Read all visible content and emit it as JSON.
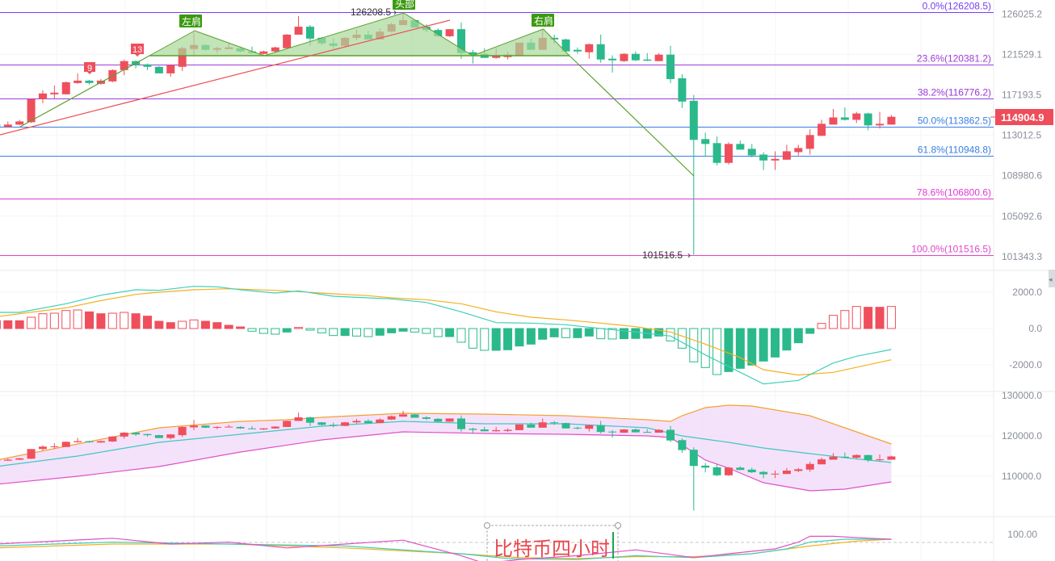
{
  "chart_data": {
    "type": "candlestick",
    "title": "比特币四小时",
    "colors": {
      "up": "#ef4f5c",
      "down": "#2bb98b",
      "fib0": "#7a3df0",
      "fib236": "#a23ad8",
      "fib382": "#9a3ad8",
      "fib50": "#3a7ee0",
      "fib618": "#3a7ee0",
      "fib786": "#e03ad0",
      "fib100": "#e048c8",
      "trend_red": "#ef4f5c",
      "pattern_green": "#5aa02c",
      "pattern_fill": "#a8d89a",
      "dif": "#3fd0b8",
      "dea": "#f5b020",
      "k": "#3fd0b8",
      "d": "#f5b020",
      "j": "#e050c8",
      "boll_up": "#f5a030",
      "boll_mid": "#3fc8c0",
      "boll_low": "#e050c8",
      "boll_fill": "#f0d8f8",
      "price_tag": "#ee4d5a"
    },
    "price_axis": {
      "scale": "log",
      "ticks": [
        "126025.2",
        "121529.1",
        "117193.5",
        "113012.5",
        "108980.6",
        "105092.6",
        "101343.3"
      ]
    },
    "current_price": "114904.9",
    "candles_ohlc": [
      [
        114102,
        114265,
        113938,
        113856
      ],
      [
        113856,
        114429,
        113856,
        114102
      ],
      [
        114102,
        114593,
        114020,
        114429
      ],
      [
        114347,
        116743,
        114265,
        116743
      ],
      [
        116743,
        117678,
        116318,
        117338
      ],
      [
        117253,
        118188,
        116743,
        117423
      ],
      [
        117253,
        118613,
        117253,
        118528
      ],
      [
        118443,
        119476,
        118358,
        118698
      ],
      [
        118698,
        118783,
        118273,
        118443
      ],
      [
        118358,
        118868,
        118273,
        118698
      ],
      [
        118613,
        119917,
        118528,
        119829
      ],
      [
        119829,
        120974,
        119293,
        120798
      ],
      [
        120798,
        120886,
        120005,
        120357
      ],
      [
        120445,
        120533,
        119829,
        120181
      ],
      [
        120181,
        120269,
        119476,
        119476
      ],
      [
        119476,
        120445,
        119123,
        120357
      ],
      [
        120181,
        122383,
        119741,
        122207
      ],
      [
        122119,
        123950,
        121415,
        122559
      ],
      [
        122559,
        122648,
        121942,
        122031
      ],
      [
        122031,
        122383,
        121678,
        122207
      ],
      [
        122119,
        122736,
        122119,
        122295
      ],
      [
        122207,
        122383,
        121766,
        121854
      ],
      [
        121854,
        122383,
        121591,
        121678
      ],
      [
        121591,
        121942,
        121503,
        121854
      ],
      [
        121854,
        122383,
        121766,
        122295
      ],
      [
        122207,
        123767,
        122207,
        123705
      ],
      [
        123705,
        125778,
        123705,
        124590
      ],
      [
        124590,
        124773,
        122471,
        123264
      ],
      [
        123352,
        123441,
        122559,
        122736
      ],
      [
        122736,
        123264,
        122119,
        122471
      ],
      [
        122471,
        123441,
        122383,
        123352
      ],
      [
        123352,
        124224,
        123088,
        123705
      ],
      [
        123705,
        124133,
        123176,
        123176
      ],
      [
        123176,
        124407,
        123176,
        124042
      ],
      [
        124042,
        125047,
        123950,
        124864
      ],
      [
        124773,
        126208.5,
        124773,
        125321
      ],
      [
        125321,
        125400,
        124499,
        124499
      ],
      [
        124590,
        124864,
        123950,
        124224
      ],
      [
        124224,
        124407,
        123441,
        123529
      ],
      [
        123529,
        124316,
        123441,
        124316
      ],
      [
        124316,
        125047,
        121062,
        121678
      ],
      [
        121766,
        122031,
        120533,
        121503
      ],
      [
        121591,
        122207,
        121150,
        121150
      ],
      [
        121150,
        122207,
        121062,
        121415
      ],
      [
        121238,
        121854,
        120974,
        121503
      ],
      [
        121415,
        122824,
        121415,
        122824
      ],
      [
        122824,
        123264,
        122031,
        122031
      ],
      [
        122031,
        124316,
        122031,
        123352
      ],
      [
        123352,
        123705,
        122736,
        123176
      ],
      [
        123176,
        123264,
        121854,
        121854
      ],
      [
        122031,
        122295,
        121591,
        121854
      ],
      [
        121766,
        122736,
        121062,
        122648
      ],
      [
        122648,
        123705,
        120622,
        120974
      ],
      [
        121062,
        121415,
        119564,
        120886
      ],
      [
        120798,
        121678,
        120710,
        121591
      ],
      [
        121591,
        121854,
        120798,
        120886
      ],
      [
        120974,
        121678,
        120798,
        120886
      ],
      [
        120798,
        121678,
        120798,
        121503
      ],
      [
        121503,
        122471,
        118443,
        118868
      ],
      [
        118953,
        119388,
        115808,
        116488
      ],
      [
        116573,
        117168,
        101516.5,
        112546
      ],
      [
        112628,
        113283,
        110956,
        112136
      ],
      [
        112218,
        112873,
        110008,
        110245
      ],
      [
        110245,
        112300,
        110087,
        112136
      ],
      [
        112136,
        112464,
        111563,
        111563
      ],
      [
        111645,
        112136,
        110798,
        110990
      ],
      [
        111071,
        111317,
        109534,
        110482
      ],
      [
        110482,
        111399,
        109534,
        110640
      ],
      [
        110561,
        112054,
        110561,
        111399
      ],
      [
        111317,
        112054,
        110990,
        111727
      ],
      [
        111645,
        113610,
        111071,
        113037
      ],
      [
        112955,
        114593,
        112955,
        114183
      ],
      [
        114102,
        115723,
        114102,
        114839
      ],
      [
        114839,
        115893,
        114511,
        114593
      ],
      [
        114593,
        115412,
        114265,
        115248
      ],
      [
        115248,
        115330,
        113528,
        114020
      ],
      [
        114020,
        115412,
        113692,
        114183
      ],
      [
        114102,
        115084,
        114102,
        114904.9
      ]
    ],
    "fibonacci": [
      {
        "level": "0.0%",
        "price": 126208.5,
        "label": "0.0%(126208.5)",
        "color_key": "fib0"
      },
      {
        "level": "23.6%",
        "price": 120381.2,
        "label": "23.6%(120381.2)",
        "color_key": "fib236"
      },
      {
        "level": "38.2%",
        "price": 116776.2,
        "label": "38.2%(116776.2)",
        "color_key": "fib382"
      },
      {
        "level": "50.0%",
        "price": 113862.5,
        "label": "50.0%(113862.5)",
        "color_key": "fib50"
      },
      {
        "level": "61.8%",
        "price": 110948.8,
        "label": "61.8%(110948.8)",
        "color_key": "fib618"
      },
      {
        "level": "78.6%",
        "price": 106800.6,
        "label": "78.6%(106800.6)",
        "color_key": "fib786"
      },
      {
        "level": "100.0%",
        "price": 101516.5,
        "label": "100.0%(101516.5)",
        "color_key": "fib100"
      }
    ],
    "annotations": {
      "high_label": "126208.5",
      "low_label": "101516.5",
      "left_shoulder": "左肩",
      "head": "头部",
      "right_shoulder": "右肩",
      "count_9": "9",
      "count_13": "13",
      "note_text": "比特币四小时"
    },
    "macd": {
      "ticks": [
        "2000.0",
        "0.0",
        "-2000.0"
      ],
      "histogram": [
        429,
        429,
        429,
        622,
        815,
        844,
        992,
        1022,
        918,
        815,
        844,
        889,
        815,
        681,
        400,
        326,
        400,
        474,
        400,
        326,
        178,
        89,
        -148,
        -267,
        -311,
        -193,
        59,
        -89,
        -237,
        -385,
        -385,
        -415,
        -444,
        -370,
        -237,
        -148,
        -193,
        -267,
        -444,
        -444,
        -755,
        -1081,
        -1200,
        -1200,
        -1170,
        -963,
        -859,
        -592,
        -459,
        -504,
        -504,
        -415,
        -563,
        -575,
        -560,
        -545,
        -530,
        -415,
        -681,
        -1081,
        -1837,
        -2148,
        -2533,
        -2370,
        -2192,
        -2014,
        -1792,
        -1570,
        -1185,
        -785,
        -267,
        281,
        726,
        992,
        1215,
        1170,
        1170,
        1215
      ],
      "dif": [
        [
          0,
          889
        ],
        [
          2,
          889
        ],
        [
          6,
          1363
        ],
        [
          9,
          1837
        ],
        [
          12,
          2133
        ],
        [
          14,
          2103
        ],
        [
          17,
          2325
        ],
        [
          19,
          2296
        ],
        [
          21,
          2133
        ],
        [
          24,
          1955
        ],
        [
          26,
          2073
        ],
        [
          29,
          1777
        ],
        [
          32,
          1688
        ],
        [
          34,
          1629
        ],
        [
          37,
          1437
        ],
        [
          40,
          918
        ],
        [
          43,
          326
        ],
        [
          46,
          296
        ],
        [
          49,
          207
        ],
        [
          52,
          0
        ],
        [
          55,
          -193
        ],
        [
          58,
          -415
        ],
        [
          61,
          -1452
        ],
        [
          64,
          -2414
        ],
        [
          66,
          -3051
        ],
        [
          69,
          -2858
        ],
        [
          72,
          -1896
        ],
        [
          74,
          -1526
        ],
        [
          77,
          -1155
        ]
      ],
      "dea": [
        [
          0,
          652
        ],
        [
          6,
          1140
        ],
        [
          9,
          1540
        ],
        [
          12,
          1881
        ],
        [
          14,
          2000
        ],
        [
          17,
          2133
        ],
        [
          20,
          2192
        ],
        [
          24,
          2103
        ],
        [
          26,
          2029
        ],
        [
          29,
          1910
        ],
        [
          32,
          1807
        ],
        [
          34,
          1688
        ],
        [
          37,
          1585
        ],
        [
          40,
          1363
        ],
        [
          43,
          918
        ],
        [
          46,
          622
        ],
        [
          49,
          474
        ],
        [
          52,
          296
        ],
        [
          55,
          104
        ],
        [
          58,
          -193
        ],
        [
          61,
          -859
        ],
        [
          64,
          -1600
        ],
        [
          66,
          -2266
        ],
        [
          69,
          -2562
        ],
        [
          72,
          -2414
        ],
        [
          77,
          -1718
        ]
      ]
    },
    "boll": {
      "ticks": [
        "130000.0",
        "120000.0",
        "110000.0"
      ],
      "upper": [
        [
          0,
          114000
        ],
        [
          7,
          118000
        ],
        [
          14,
          122000
        ],
        [
          21,
          123600
        ],
        [
          25,
          124000
        ],
        [
          28,
          124600
        ],
        [
          35,
          125600
        ],
        [
          42,
          125400
        ],
        [
          49,
          125000
        ],
        [
          56,
          124000
        ],
        [
          58,
          123600
        ],
        [
          59,
          125000
        ],
        [
          61,
          127000
        ],
        [
          63,
          127600
        ],
        [
          65,
          127400
        ],
        [
          70,
          125000
        ],
        [
          73,
          122000
        ],
        [
          77,
          118000
        ]
      ],
      "mid": [
        [
          0,
          112400
        ],
        [
          7,
          115000
        ],
        [
          14,
          118400
        ],
        [
          21,
          120400
        ],
        [
          28,
          122400
        ],
        [
          35,
          123600
        ],
        [
          42,
          123000
        ],
        [
          49,
          123000
        ],
        [
          56,
          122000
        ],
        [
          59,
          120000
        ],
        [
          63,
          118400
        ],
        [
          66,
          117000
        ],
        [
          70,
          115600
        ],
        [
          73,
          114600
        ],
        [
          77,
          113400
        ]
      ],
      "lower": [
        [
          0,
          108000
        ],
        [
          7,
          110000
        ],
        [
          14,
          112400
        ],
        [
          21,
          116000
        ],
        [
          28,
          119000
        ],
        [
          35,
          121000
        ],
        [
          42,
          120600
        ],
        [
          49,
          120400
        ],
        [
          56,
          120000
        ],
        [
          58,
          119600
        ],
        [
          61,
          114000
        ],
        [
          63,
          112000
        ],
        [
          66,
          108400
        ],
        [
          70,
          106400
        ],
        [
          73,
          106800
        ],
        [
          77,
          108600
        ]
      ]
    },
    "kdj": {
      "ticks": [
        "100.00"
      ],
      "k": [
        [
          0,
          88
        ],
        [
          10,
          92
        ],
        [
          20,
          90
        ],
        [
          30,
          88
        ],
        [
          40,
          80
        ],
        [
          44,
          75
        ],
        [
          50,
          74
        ],
        [
          55,
          78
        ],
        [
          60,
          76
        ],
        [
          65,
          80
        ],
        [
          68,
          85
        ],
        [
          70,
          92
        ],
        [
          73,
          95
        ],
        [
          77,
          95
        ]
      ],
      "d": [
        [
          0,
          86
        ],
        [
          10,
          90
        ],
        [
          20,
          90
        ],
        [
          30,
          86
        ],
        [
          40,
          80
        ],
        [
          45,
          76
        ],
        [
          50,
          75
        ],
        [
          55,
          77
        ],
        [
          60,
          77
        ],
        [
          65,
          80
        ],
        [
          70,
          88
        ],
        [
          74,
          93
        ],
        [
          77,
          95
        ]
      ],
      "j": [
        [
          0,
          90
        ],
        [
          5,
          93
        ],
        [
          10,
          96
        ],
        [
          15,
          90
        ],
        [
          20,
          92
        ],
        [
          25,
          86
        ],
        [
          30,
          90
        ],
        [
          35,
          94
        ],
        [
          40,
          78
        ],
        [
          42,
          70
        ],
        [
          45,
          74
        ],
        [
          50,
          78
        ],
        [
          55,
          84
        ],
        [
          60,
          76
        ],
        [
          63,
          80
        ],
        [
          67,
          85
        ],
        [
          69,
          92
        ],
        [
          70,
          98
        ],
        [
          72,
          98
        ],
        [
          75,
          96
        ],
        [
          77,
          95
        ]
      ]
    }
  }
}
